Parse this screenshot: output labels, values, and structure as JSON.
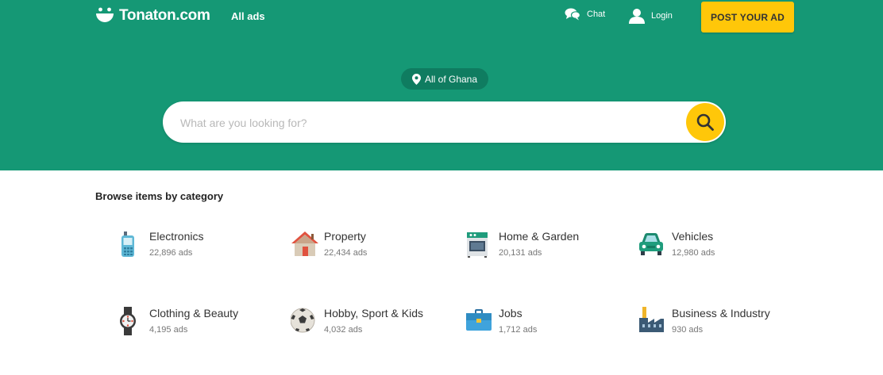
{
  "header": {
    "logo_text": "Tonaton.com",
    "all_ads": "All ads",
    "chat": "Chat",
    "login": "Login",
    "post_ad": "POST YOUR AD"
  },
  "search": {
    "location": "All of Ghana",
    "placeholder": "What are you looking for?"
  },
  "browse": {
    "title": "Browse items by category",
    "categories": [
      {
        "name": "Electronics",
        "count": "22,896 ads",
        "icon": "mobile-phone-icon"
      },
      {
        "name": "Property",
        "count": "22,434 ads",
        "icon": "house-icon"
      },
      {
        "name": "Home & Garden",
        "count": "20,131 ads",
        "icon": "stove-icon"
      },
      {
        "name": "Vehicles",
        "count": "12,980 ads",
        "icon": "car-icon"
      },
      {
        "name": "Clothing & Beauty",
        "count": "4,195 ads",
        "icon": "watch-icon"
      },
      {
        "name": "Hobby, Sport & Kids",
        "count": "4,032 ads",
        "icon": "football-icon"
      },
      {
        "name": "Jobs",
        "count": "1,712 ads",
        "icon": "briefcase-icon"
      },
      {
        "name": "Business & Industry",
        "count": "930 ads",
        "icon": "factory-icon"
      }
    ]
  },
  "colors": {
    "brand_green": "#159875",
    "pill_green": "#0f7c60",
    "accent_yellow": "#ffc709"
  }
}
